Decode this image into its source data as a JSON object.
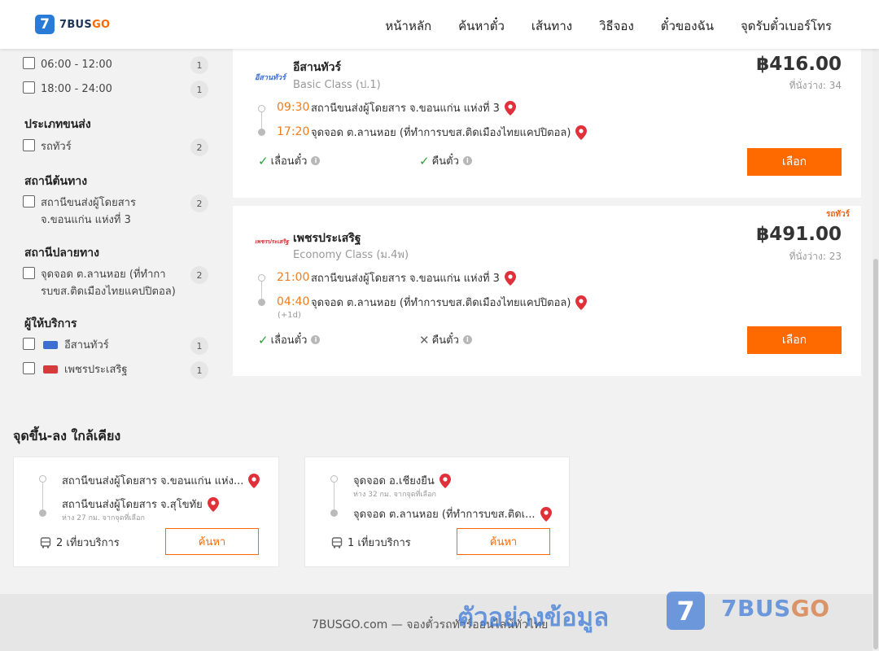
{
  "header": {
    "logo_glyph": "7",
    "logo_text_a": "7BUS",
    "logo_text_b": "GO",
    "nav": [
      "หน้าหลัก",
      "ค้นหาตั๋ว",
      "เส้นทาง",
      "วิธีจอง",
      "ตั๋วของฉัน",
      "จุดรับตั๋วเบอร์โทร"
    ]
  },
  "filters": {
    "time_slots": [
      {
        "label": "06:00 - 12:00",
        "count": "1"
      },
      {
        "label": "18:00 - 24:00",
        "count": "1"
      }
    ],
    "transport_type_title": "ประเภทขนส่ง",
    "transport_types": [
      {
        "label": "รถทัวร์",
        "count": "2"
      }
    ],
    "origin_title": "สถานีต้นทาง",
    "origins": [
      {
        "label": "สถานีขนส่งผู้โดยสาร จ.ขอนแก่น แห่งที่ 3",
        "count": "2"
      }
    ],
    "dest_title": "สถานีปลายทาง",
    "destinations": [
      {
        "label": "จุดจอด ต.ลานหอย (ที่ทำการบขส.ติดเมืองไทยแคปปิตอล)",
        "count": "2"
      }
    ],
    "operator_title": "ผู้ให้บริการ",
    "operators": [
      {
        "label": "อีสานทัวร์",
        "count": "1",
        "logo_color": "#3b6fd1"
      },
      {
        "label": "เพชรประเสริฐ",
        "count": "1",
        "logo_color": "#d63a3a"
      }
    ]
  },
  "results": [
    {
      "operator_logo": "อีสานทัวร์",
      "operator": "อีสานทัวร์",
      "class": "Basic Class (ป.1)",
      "price": "฿416.00",
      "seats": "ที่นั่งว่าง: 34",
      "dep_time": "09:30",
      "dep_station": "สถานีขนส่งผู้โดยสาร จ.ขอนแก่น แห่งที่ 3",
      "arr_time": "17:20",
      "arr_station": "จุดจอด ต.ลานหอย (ที่ทำการบขส.ติดเมืองไทยแคปปิตอล)",
      "change_label": "เลื่อนตั๋ว",
      "refund_label": "คืนตั๋ว",
      "button": "เลือก"
    },
    {
      "tag": "รถทัวร์",
      "operator_logo": "เพชรประเสริฐ",
      "operator": "เพชรประเสริฐ",
      "class": "Economy Class (ม.4พ)",
      "price": "฿491.00",
      "seats": "ที่นั่งว่าง: 23",
      "dep_time": "21:00",
      "dep_station": "สถานีขนส่งผู้โดยสาร จ.ขอนแก่น แห่งที่ 3",
      "arr_time": "04:40",
      "arr_plus": "(+1d)",
      "arr_station": "จุดจอด ต.ลานหอย (ที่ทำการบขส.ติดเมืองไทยแคปปิตอล)",
      "change_label": "เลื่อนตั๋ว",
      "refund_label": "คืนตั๋ว",
      "button": "เลือก"
    }
  ],
  "nearby": {
    "title": "จุดขึ้น-ลง ใกล้เคียง",
    "cards": [
      {
        "from": "สถานีขนส่งผู้โดยสาร จ.ขอนแก่น แห่ง...",
        "from_dist": "",
        "to": "สถานีขนส่งผู้โดยสาร จ.สุโขทัย",
        "to_dist": "ห่าง 27 กม. จากจุดที่เลือก",
        "trips": "2 เที่ยวบริการ",
        "button": "ค้นหา"
      },
      {
        "from": "จุดจอด อ.เชียงยืน",
        "from_dist": "ห่าง 32 กม. จากจุดที่เลือก",
        "to": "จุดจอด ต.ลานหอย (ที่ทำการบขส.ติดเ...",
        "to_dist": "",
        "trips": "1 เที่ยวบริการ",
        "button": "ค้นหา"
      }
    ]
  },
  "footer": {
    "text": "7BUSGO.com — จองตั๋วรถทัวร์ออนไลน์ทั่วไทย"
  },
  "watermark": {
    "text": "ตัวอย่างข้อมูล",
    "logo_glyph": "7",
    "brand_a": "7BUS",
    "brand_b": "GO"
  }
}
